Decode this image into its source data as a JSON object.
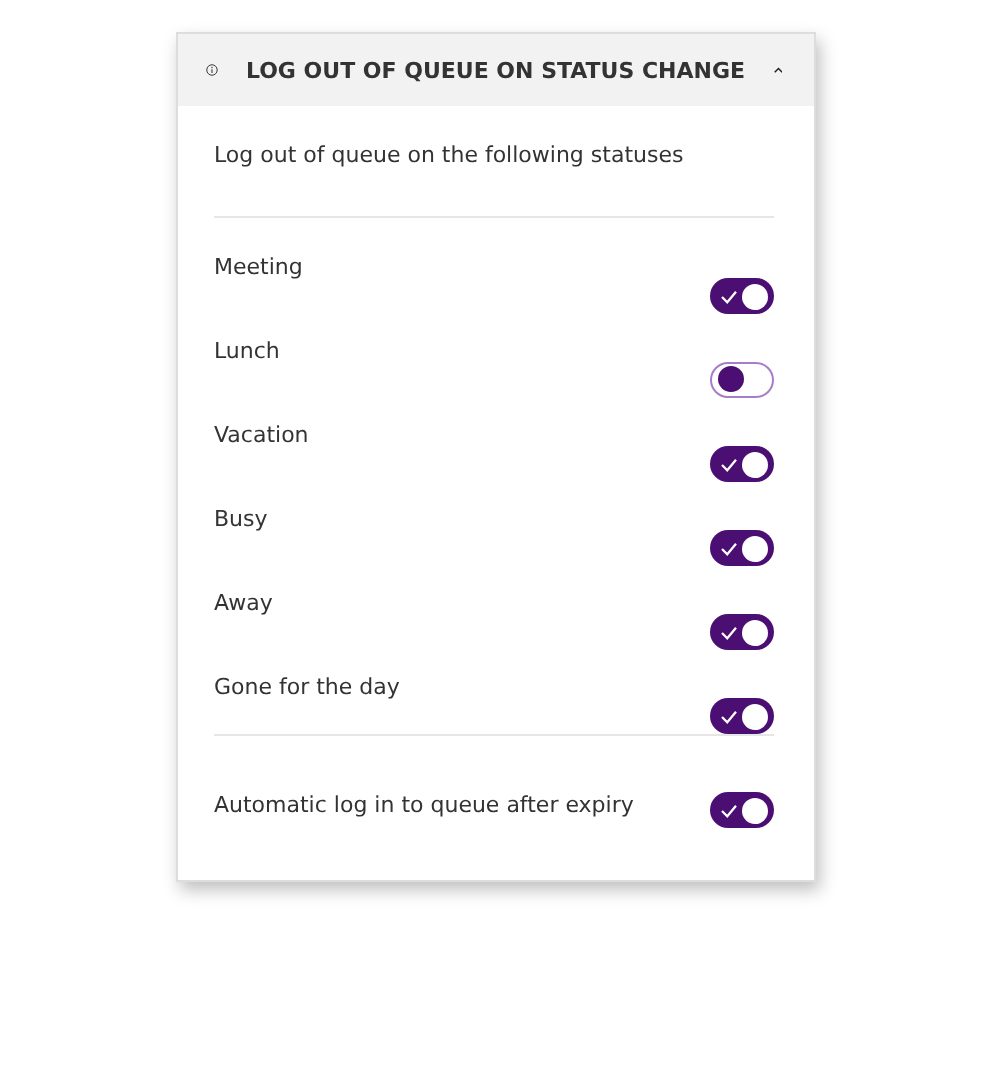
{
  "panel": {
    "title": "LOG OUT OF QUEUE ON STATUS CHANGE",
    "expanded": true,
    "description": "Log out of queue on the following statuses",
    "statuses": [
      {
        "label": "Meeting",
        "on": true
      },
      {
        "label": "Lunch",
        "on": false
      },
      {
        "label": "Vacation",
        "on": true
      },
      {
        "label": "Busy",
        "on": true
      },
      {
        "label": "Away",
        "on": true
      },
      {
        "label": "Gone for the day",
        "on": true
      }
    ],
    "auto_login": {
      "label": "Automatic log in to queue after expiry",
      "on": true
    }
  }
}
